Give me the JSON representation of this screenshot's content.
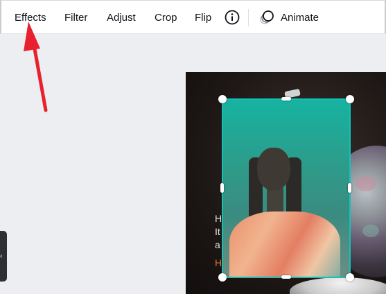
{
  "toolbar": {
    "effects_label": "Effects",
    "filter_label": "Filter",
    "adjust_label": "Adjust",
    "crop_label": "Crop",
    "flip_label": "Flip",
    "info_icon": "info-icon",
    "animate_label": "Animate",
    "animate_icon": "animate-icon"
  },
  "design": {
    "text_line1": "H",
    "text_line2": "It",
    "text_line3": "a",
    "text_line4": "H"
  },
  "side_panel": {
    "toggle_label": "‹"
  },
  "colors": {
    "selection": "#13c1b8",
    "annotation_arrow": "#e8212e",
    "toolbar_bg": "#ffffff",
    "canvas_bg": "#eceef1"
  }
}
